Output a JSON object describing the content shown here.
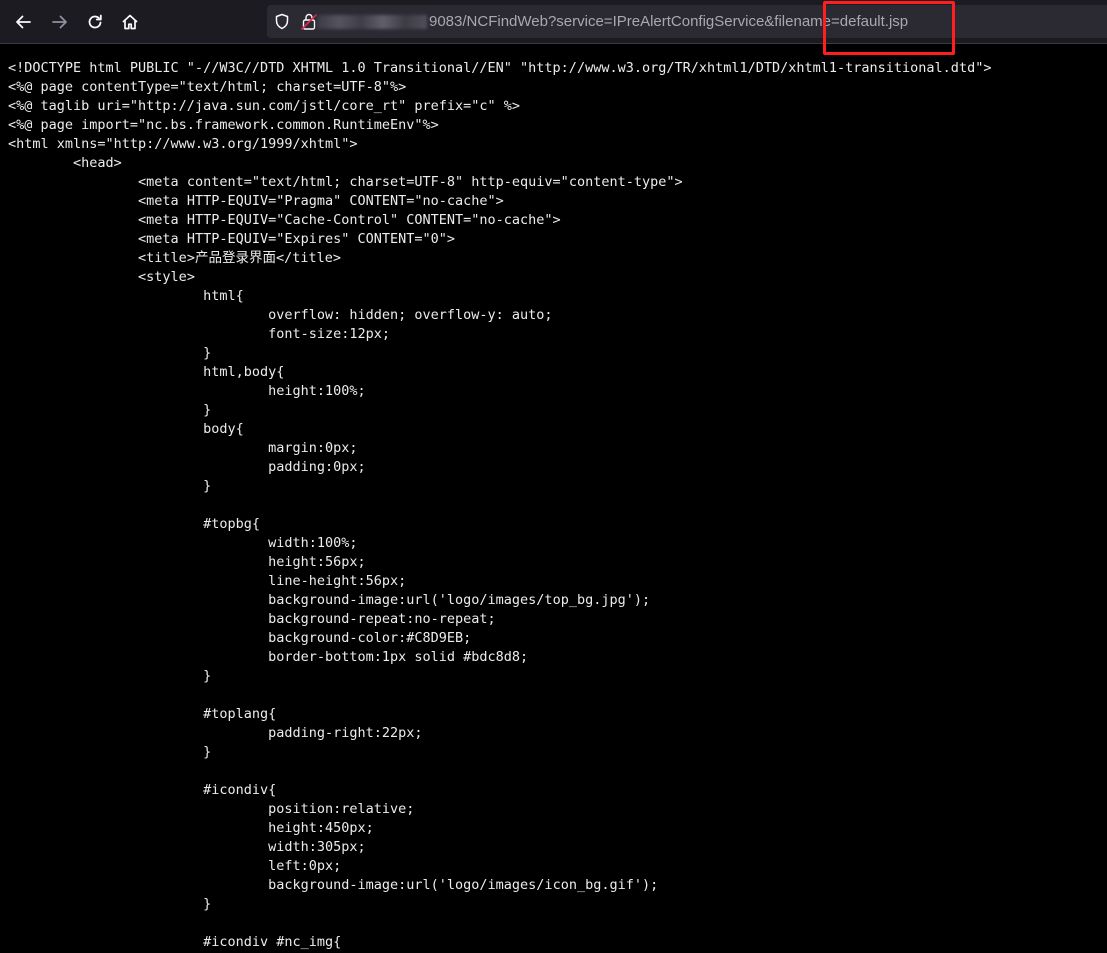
{
  "browser": {
    "url": {
      "visible_text": "9083/NCFindWeb?service=IPreAlertConfigService&filename=default.jsp"
    },
    "icons": {
      "back": "arrow-left-icon",
      "forward": "arrow-right-icon",
      "reload": "reload-icon",
      "home": "home-icon",
      "tracking_protection": "shield-icon",
      "connection": "lock-icon"
    },
    "highlight_color": "#ff1f1f"
  },
  "source_lines": [
    "<!DOCTYPE html PUBLIC \"-//W3C//DTD XHTML 1.0 Transitional//EN\" \"http://www.w3.org/TR/xhtml1/DTD/xhtml1-transitional.dtd\">",
    "<%@ page contentType=\"text/html; charset=UTF-8\"%>",
    "<%@ taglib uri=\"http://java.sun.com/jstl/core_rt\" prefix=\"c\" %>",
    "<%@ page import=\"nc.bs.framework.common.RuntimeEnv\"%>",
    "<html xmlns=\"http://www.w3.org/1999/xhtml\">",
    "\t<head>",
    "\t\t<meta content=\"text/html; charset=UTF-8\" http-equiv=\"content-type\">",
    "\t\t<meta HTTP-EQUIV=\"Pragma\" CONTENT=\"no-cache\">",
    "\t\t<meta HTTP-EQUIV=\"Cache-Control\" CONTENT=\"no-cache\">",
    "\t\t<meta HTTP-EQUIV=\"Expires\" CONTENT=\"0\">",
    "\t\t<title>产品登录界面</title>",
    "\t\t<style>",
    "\t\t\thtml{",
    "\t\t\t\toverflow: hidden; overflow-y: auto;",
    "\t\t\t\tfont-size:12px;",
    "\t\t\t}",
    "\t\t\thtml,body{",
    "\t\t\t\theight:100%;",
    "\t\t\t}",
    "\t\t\tbody{",
    "\t\t\t\tmargin:0px;",
    "\t\t\t\tpadding:0px;",
    "\t\t\t}",
    "",
    "\t\t\t#topbg{",
    "\t\t\t\twidth:100%;",
    "\t\t\t\theight:56px;",
    "\t\t\t\tline-height:56px;",
    "\t\t\t\tbackground-image:url('logo/images/top_bg.jpg');",
    "\t\t\t\tbackground-repeat:no-repeat;",
    "\t\t\t\tbackground-color:#C8D9EB;",
    "\t\t\t\tborder-bottom:1px solid #bdc8d8;",
    "\t\t\t}",
    "",
    "\t\t\t#toplang{",
    "\t\t\t\tpadding-right:22px;",
    "\t\t\t}",
    "",
    "\t\t\t#icondiv{",
    "\t\t\t\tposition:relative;",
    "\t\t\t\theight:450px;",
    "\t\t\t\twidth:305px;",
    "\t\t\t\tleft:0px;",
    "\t\t\t\tbackground-image:url('logo/images/icon_bg.gif');",
    "\t\t\t}",
    "",
    "\t\t\t#icondiv #nc_img{"
  ]
}
